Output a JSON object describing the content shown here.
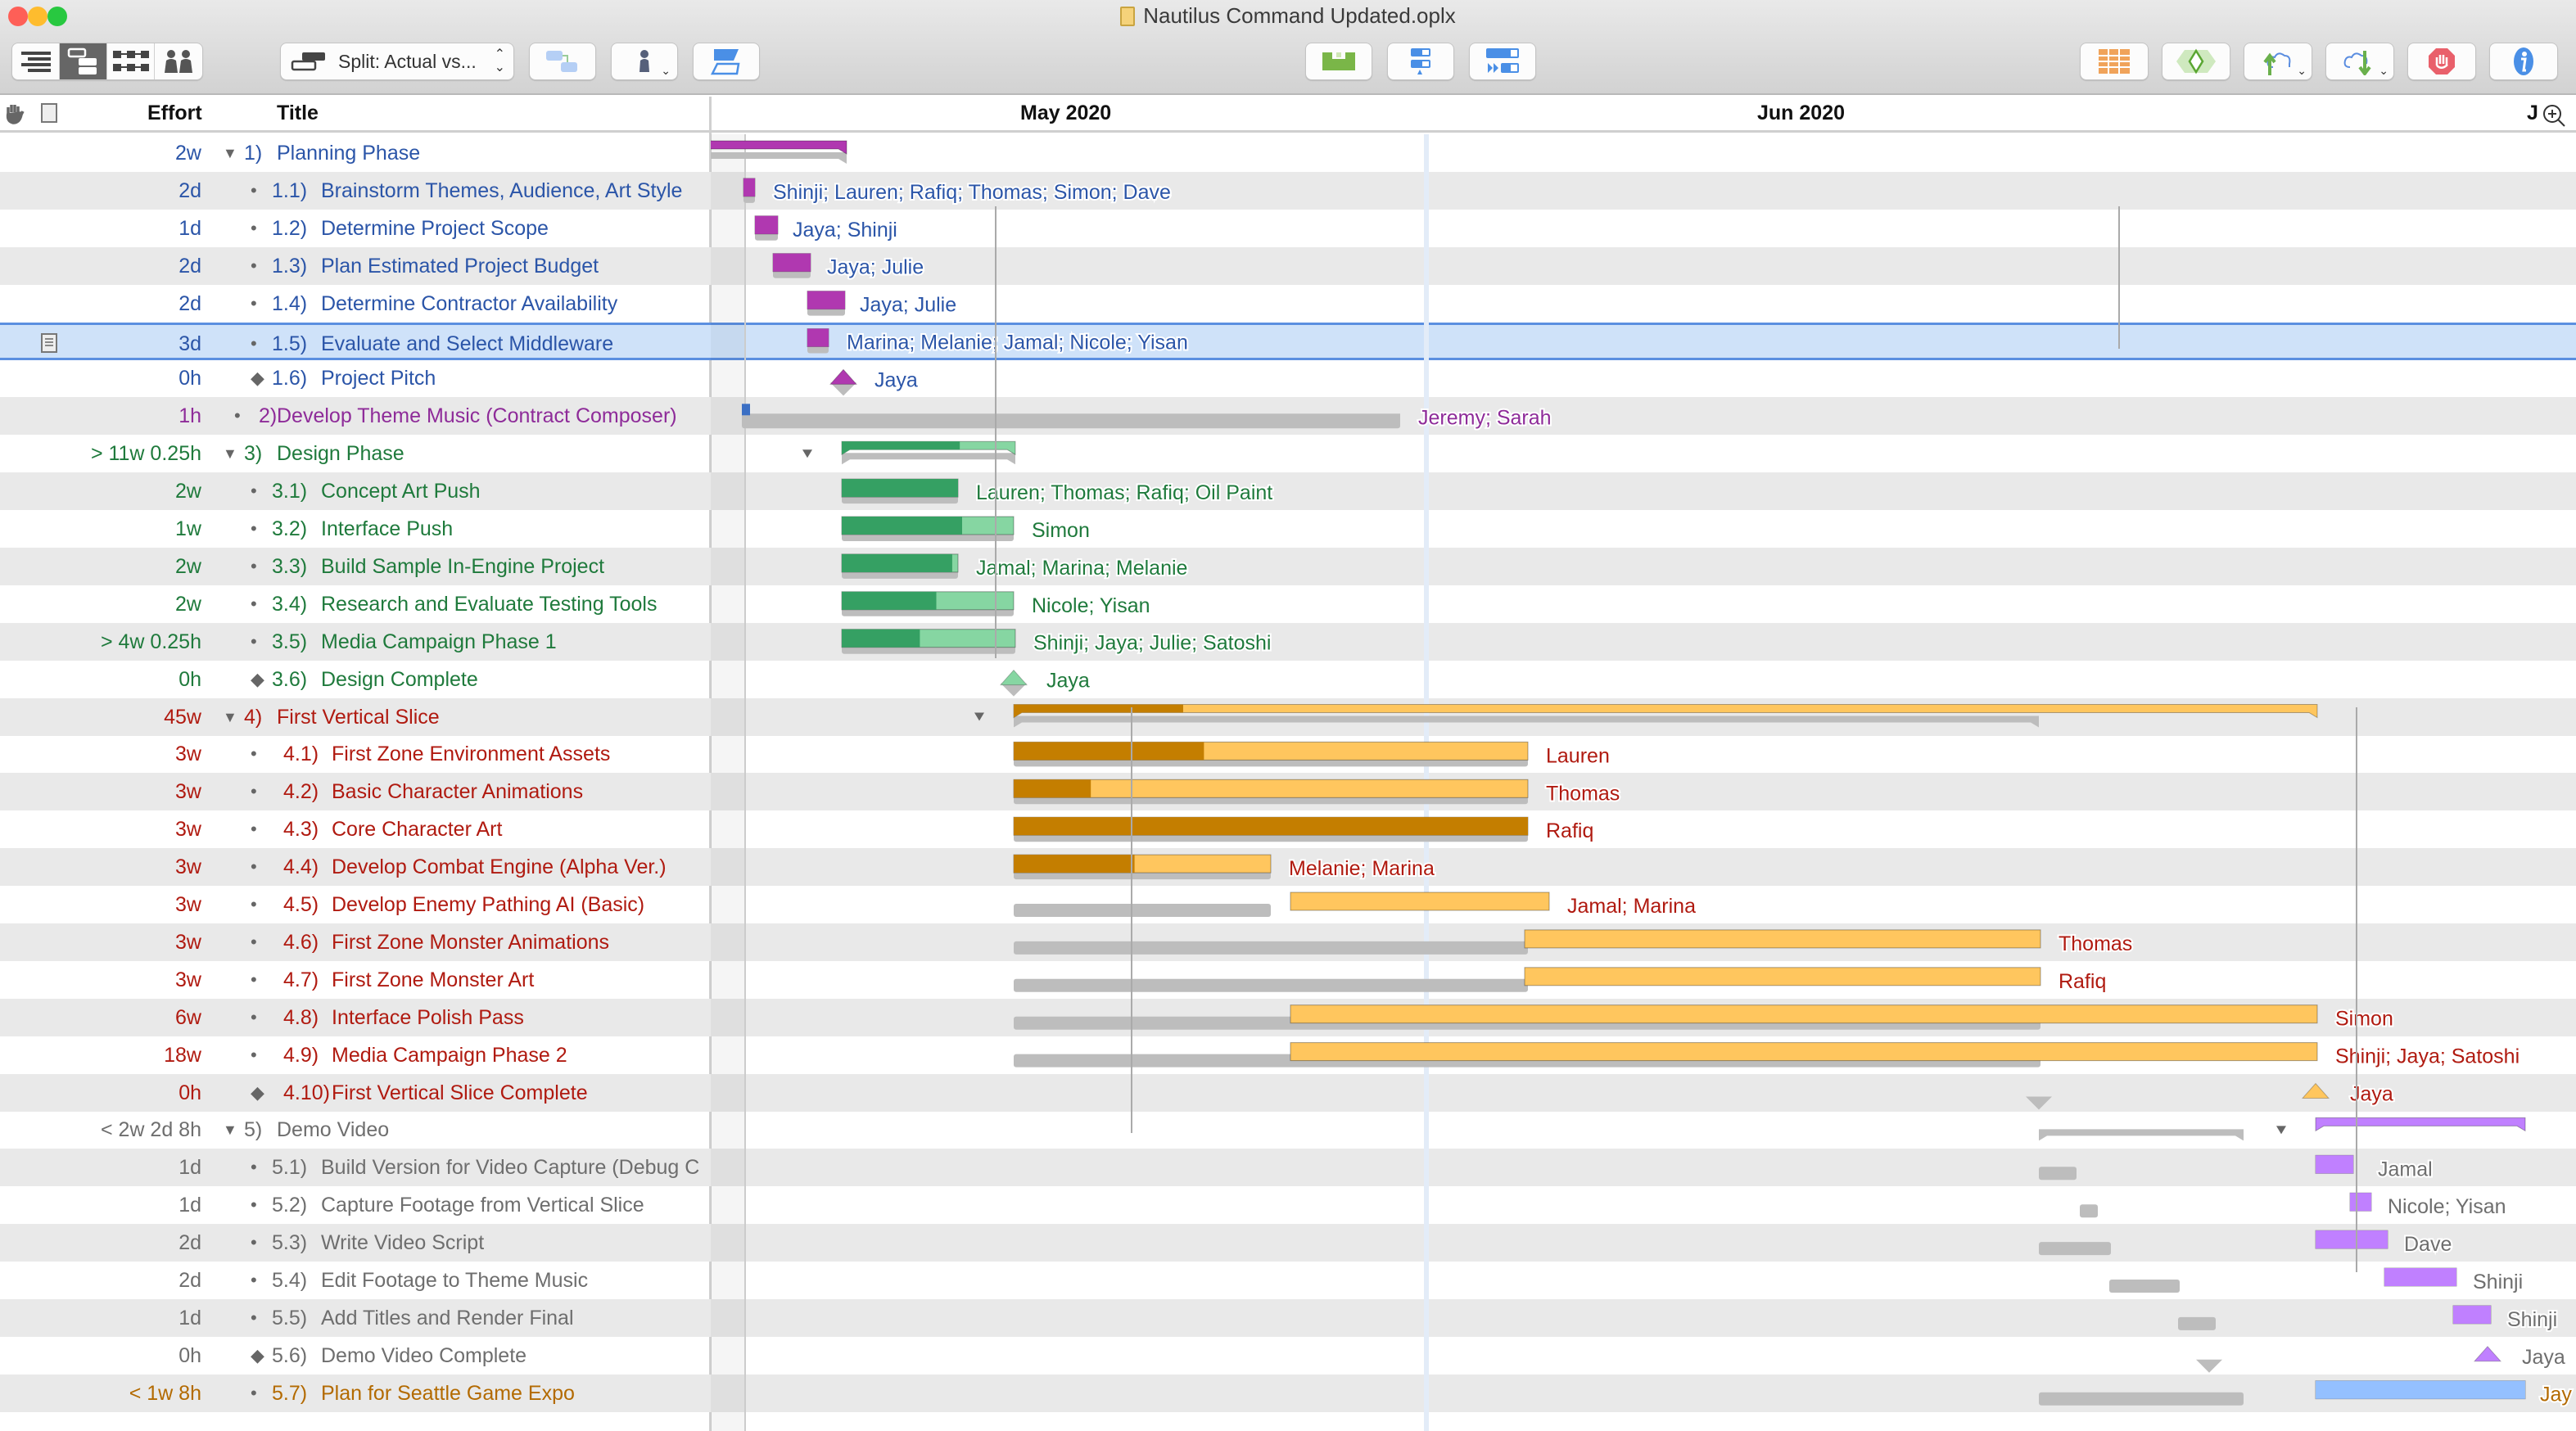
{
  "window": {
    "title": "Nautilus Command Updated.oplx"
  },
  "toolbar": {
    "view_buttons": [
      {
        "name": "outline-view-button",
        "icon": "outline-lines-icon"
      },
      {
        "name": "gantt-view-button",
        "icon": "gantt-split-icon",
        "active": true
      },
      {
        "name": "network-view-button",
        "icon": "network-icon"
      },
      {
        "name": "resource-view-button",
        "icon": "people-icon"
      }
    ],
    "baseline_select": {
      "value": "Split: Actual vs...",
      "icon": "split-bars-icon"
    },
    "left_buttons": [
      "connect-tasks-icon",
      "assign-resource-icon",
      "style-icon"
    ],
    "center_buttons": [
      "level-resources-icon",
      "catch-up-icon",
      "reschedule-icon"
    ],
    "right_buttons": [
      "table-icon",
      "milestone-diamond-icon",
      "publish-up-icon",
      "publish-down-icon",
      "violations-stop-icon",
      "inspector-info-icon"
    ]
  },
  "columns": {
    "effort": "Effort",
    "title": "Title",
    "hand_icon": "hand-icon",
    "note_icon": "note-icon"
  },
  "timeline": {
    "months": [
      "May 2020",
      "Jun 2020",
      "J"
    ],
    "zoom_icon": "zoom-in-icon"
  },
  "colors": {
    "planning": "#2b55a8",
    "music": "#8e2b99",
    "design": "#1f7a3c",
    "slice": "#b01a10",
    "demo": "#6e6e6e",
    "expo": "#b36a00",
    "bar_purple": "#b038b0",
    "bar_green_done": "#35a063",
    "bar_green": "#86d6a2",
    "bar_orange_done": "#c47e00",
    "bar_orange": "#ffc65e",
    "bar_lilac": "#c080ff",
    "bar_blue": "#94c0ff",
    "baseline": "#bdbdbd",
    "selection": "#cfe2f9"
  },
  "rows": [
    {
      "effort": "2w",
      "marker": "▼",
      "num": "1)",
      "title": "Planning Phase",
      "group": "planning",
      "kind": "group",
      "resources": ""
    },
    {
      "effort": "2d",
      "marker": "•",
      "num": "1.1)",
      "title": "Brainstorm Themes, Audience, Art Style",
      "group": "planning",
      "kind": "task",
      "resources": "Shinji; Lauren; Rafiq; Thomas; Simon; Dave"
    },
    {
      "effort": "1d",
      "marker": "•",
      "num": "1.2)",
      "title": "Determine Project Scope",
      "group": "planning",
      "kind": "task",
      "resources": "Jaya; Shinji"
    },
    {
      "effort": "2d",
      "marker": "•",
      "num": "1.3)",
      "title": "Plan Estimated Project Budget",
      "group": "planning",
      "kind": "task",
      "resources": "Jaya; Julie"
    },
    {
      "effort": "2d",
      "marker": "•",
      "num": "1.4)",
      "title": "Determine Contractor Availability",
      "group": "planning",
      "kind": "task",
      "resources": "Jaya; Julie"
    },
    {
      "effort": "3d",
      "marker": "•",
      "num": "1.5)",
      "title": "Evaluate and Select Middleware",
      "group": "planning",
      "kind": "task",
      "resources": "Marina; Melanie; Jamal; Nicole; Yisan",
      "selected": true,
      "has_note": true
    },
    {
      "effort": "0h",
      "marker": "◆",
      "num": "1.6)",
      "title": "Project Pitch",
      "group": "planning",
      "kind": "milestone",
      "resources": "Jaya"
    },
    {
      "effort": "1h",
      "marker": "•",
      "num": "2)",
      "title": "Develop Theme Music (Contract Composer)",
      "group": "music",
      "kind": "task",
      "resources": "Jeremy; Sarah"
    },
    {
      "effort": "> 11w 0.25h",
      "marker": "▼",
      "num": "3)",
      "title": "Design Phase",
      "group": "design",
      "kind": "group",
      "resources": ""
    },
    {
      "effort": "2w",
      "marker": "•",
      "num": "3.1)",
      "title": "Concept Art Push",
      "group": "design",
      "kind": "task",
      "resources": "Lauren; Thomas; Rafiq; Oil Paint"
    },
    {
      "effort": "1w",
      "marker": "•",
      "num": "3.2)",
      "title": "Interface Push",
      "group": "design",
      "kind": "task",
      "resources": "Simon"
    },
    {
      "effort": "2w",
      "marker": "•",
      "num": "3.3)",
      "title": "Build Sample In-Engine Project",
      "group": "design",
      "kind": "task",
      "resources": "Jamal; Marina; Melanie"
    },
    {
      "effort": "2w",
      "marker": "•",
      "num": "3.4)",
      "title": "Research and Evaluate Testing Tools",
      "group": "design",
      "kind": "task",
      "resources": "Nicole; Yisan"
    },
    {
      "effort": "> 4w 0.25h",
      "marker": "•",
      "num": "3.5)",
      "title": "Media Campaign Phase 1",
      "group": "design",
      "kind": "task",
      "resources": "Shinji; Jaya; Julie; Satoshi"
    },
    {
      "effort": "0h",
      "marker": "◆",
      "num": "3.6)",
      "title": "Design Complete",
      "group": "design",
      "kind": "milestone",
      "resources": "Jaya"
    },
    {
      "effort": "45w",
      "marker": "▼",
      "num": "4)",
      "title": "First Vertical Slice",
      "group": "slice",
      "kind": "group",
      "resources": ""
    },
    {
      "effort": "3w",
      "marker": "•",
      "num": "4.1)",
      "title": "First Zone Environment Assets",
      "group": "slice",
      "kind": "task",
      "resources": "Lauren"
    },
    {
      "effort": "3w",
      "marker": "•",
      "num": "4.2)",
      "title": "Basic Character Animations",
      "group": "slice",
      "kind": "task",
      "resources": "Thomas"
    },
    {
      "effort": "3w",
      "marker": "•",
      "num": "4.3)",
      "title": "Core Character Art",
      "group": "slice",
      "kind": "task",
      "resources": "Rafiq"
    },
    {
      "effort": "3w",
      "marker": "•",
      "num": "4.4)",
      "title": "Develop Combat Engine (Alpha Ver.)",
      "group": "slice",
      "kind": "task",
      "resources": "Melanie; Marina"
    },
    {
      "effort": "3w",
      "marker": "•",
      "num": "4.5)",
      "title": "Develop Enemy Pathing AI (Basic)",
      "group": "slice",
      "kind": "task",
      "resources": "Jamal; Marina"
    },
    {
      "effort": "3w",
      "marker": "•",
      "num": "4.6)",
      "title": "First Zone Monster Animations",
      "group": "slice",
      "kind": "task",
      "resources": "Thomas"
    },
    {
      "effort": "3w",
      "marker": "•",
      "num": "4.7)",
      "title": "First Zone Monster Art",
      "group": "slice",
      "kind": "task",
      "resources": "Rafiq"
    },
    {
      "effort": "6w",
      "marker": "•",
      "num": "4.8)",
      "title": "Interface Polish Pass",
      "group": "slice",
      "kind": "task",
      "resources": "Simon"
    },
    {
      "effort": "18w",
      "marker": "•",
      "num": "4.9)",
      "title": "Media Campaign Phase 2",
      "group": "slice",
      "kind": "task",
      "resources": "Shinji; Jaya; Satoshi"
    },
    {
      "effort": "0h",
      "marker": "◆",
      "num": "4.10)",
      "title": "First Vertical Slice Complete",
      "group": "slice",
      "kind": "milestone",
      "resources": "Jaya"
    },
    {
      "effort": "< 2w 2d 8h",
      "marker": "▼",
      "num": "5)",
      "title": "Demo Video",
      "group": "demo",
      "kind": "group",
      "resources": ""
    },
    {
      "effort": "1d",
      "marker": "•",
      "num": "5.1)",
      "title": "Build Version for Video Capture (Debug C",
      "group": "demo",
      "kind": "task",
      "resources": "Jamal"
    },
    {
      "effort": "1d",
      "marker": "•",
      "num": "5.2)",
      "title": "Capture Footage from Vertical Slice",
      "group": "demo",
      "kind": "task",
      "resources": "Nicole; Yisan"
    },
    {
      "effort": "2d",
      "marker": "•",
      "num": "5.3)",
      "title": "Write Video Script",
      "group": "demo",
      "kind": "task",
      "resources": "Dave"
    },
    {
      "effort": "2d",
      "marker": "•",
      "num": "5.4)",
      "title": "Edit Footage to Theme Music",
      "group": "demo",
      "kind": "task",
      "resources": "Shinji"
    },
    {
      "effort": "1d",
      "marker": "•",
      "num": "5.5)",
      "title": "Add Titles and Render Final",
      "group": "demo",
      "kind": "task",
      "resources": "Shinji"
    },
    {
      "effort": "0h",
      "marker": "◆",
      "num": "5.6)",
      "title": "Demo Video Complete",
      "group": "demo",
      "kind": "milestone",
      "resources": "Jaya"
    },
    {
      "effort": "< 1w 8h",
      "marker": "•",
      "num": "5.7)",
      "title": "Plan for Seattle Game Expo",
      "group": "expo",
      "kind": "task",
      "resources": "Jay"
    }
  ]
}
